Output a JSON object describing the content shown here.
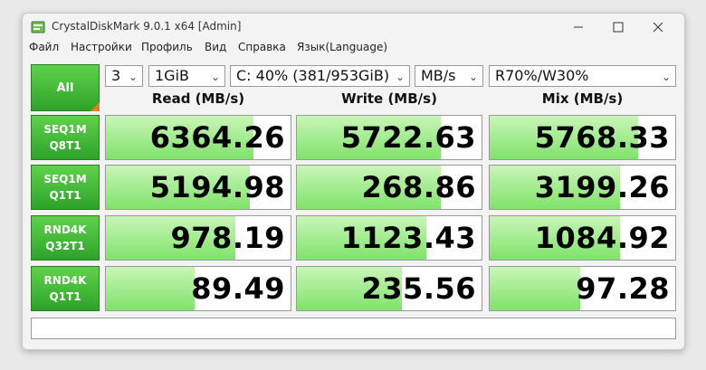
{
  "window": {
    "title": "CrystalDiskMark 9.0.1 x64 [Admin]"
  },
  "menu": [
    {
      "label": "Файл"
    },
    {
      "label": "Настройки"
    },
    {
      "label": "Профиль"
    },
    {
      "label": "Вид"
    },
    {
      "label": "Справка"
    },
    {
      "label": "Язык(Language)"
    }
  ],
  "controls": {
    "all_label": "All",
    "count": "3",
    "size": "1GiB",
    "drive": "C: 40% (381/953GiB)",
    "unit": "MB/s",
    "mix": "R70%/W30%"
  },
  "columns": [
    "Read (MB/s)",
    "Write (MB/s)",
    "Mix (MB/s)"
  ],
  "rows": [
    {
      "line1": "SEQ1M",
      "line2": "Q8T1",
      "read": "6364.26",
      "write": "5722.63",
      "mix": "5768.33",
      "read_fill": 0.8,
      "write_fill": 0.78,
      "mix_fill": 0.8
    },
    {
      "line1": "SEQ1M",
      "line2": "Q1T1",
      "read": "5194.98",
      "write": "268.86",
      "mix": "3199.26",
      "read_fill": 0.78,
      "write_fill": 0.78,
      "mix_fill": 0.7
    },
    {
      "line1": "RND4K",
      "line2": "Q32T1",
      "read": "978.19",
      "write": "1123.43",
      "mix": "1084.92",
      "read_fill": 0.7,
      "write_fill": 0.7,
      "mix_fill": 0.7
    },
    {
      "line1": "RND4K",
      "line2": "Q1T1",
      "read": "89.49",
      "write": "235.56",
      "mix": "97.28",
      "read_fill": 0.48,
      "write_fill": 0.57,
      "mix_fill": 0.49
    }
  ],
  "colors": {
    "accent_green": "#2ea32a",
    "bar_green": "#7fe36a",
    "corner_orange": "#f07a1e"
  },
  "icons": {
    "app": "crystaldiskmark-icon",
    "minimize": "minimize-icon",
    "maximize": "maximize-icon",
    "close": "close-icon"
  }
}
